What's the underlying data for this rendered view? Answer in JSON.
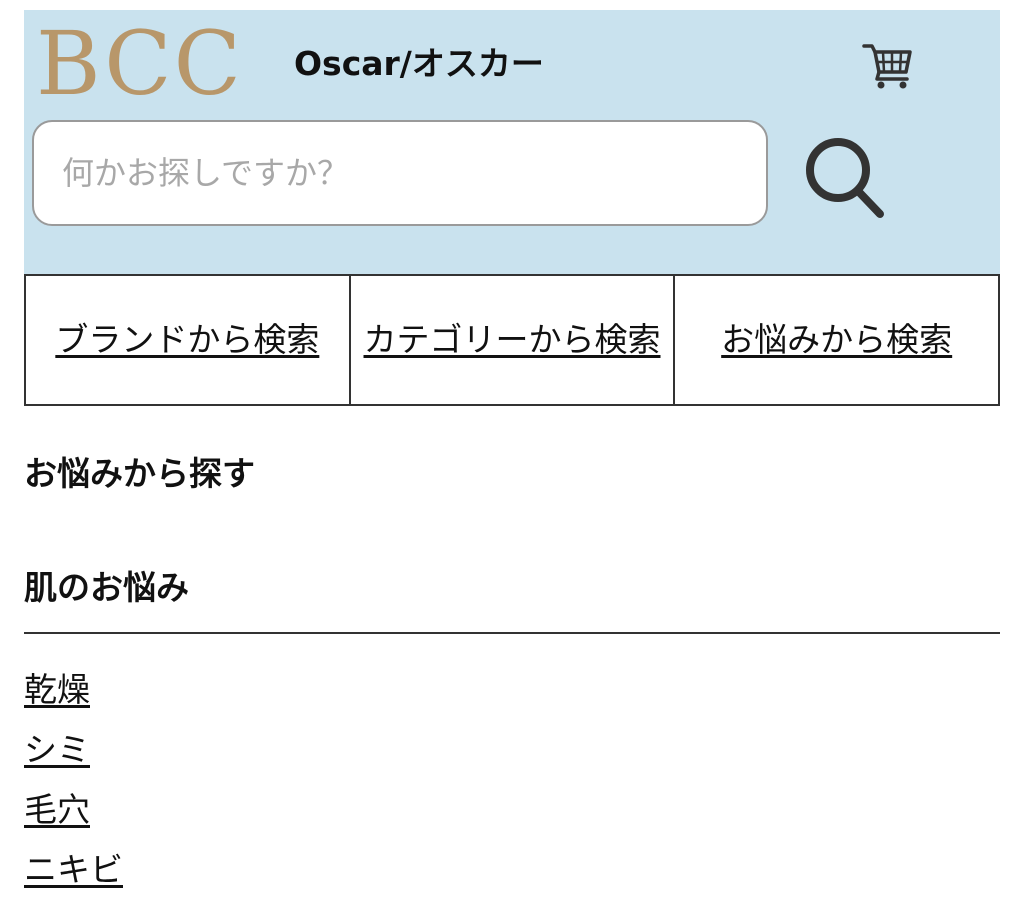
{
  "header": {
    "logo_text": "BCC",
    "shop_name": "Oscar/オスカー",
    "background_color": "#c9e2ee",
    "logo_color": "#b8976a",
    "cart_icon": "shopping-cart-icon",
    "search_icon": "magnifier-icon"
  },
  "search": {
    "placeholder": "何かお探しですか？",
    "value": ""
  },
  "nav": {
    "brand_label": "ブランドから検索",
    "category_label": "カテゴリーから検索",
    "concern_label": "お悩みから検索"
  },
  "sections": {
    "concern_search_title": "お悩みから探す",
    "skin_concerns_title": "肌のお悩み"
  },
  "concerns": [
    "乾燥",
    "シミ",
    "毛穴",
    "ニキビ"
  ]
}
